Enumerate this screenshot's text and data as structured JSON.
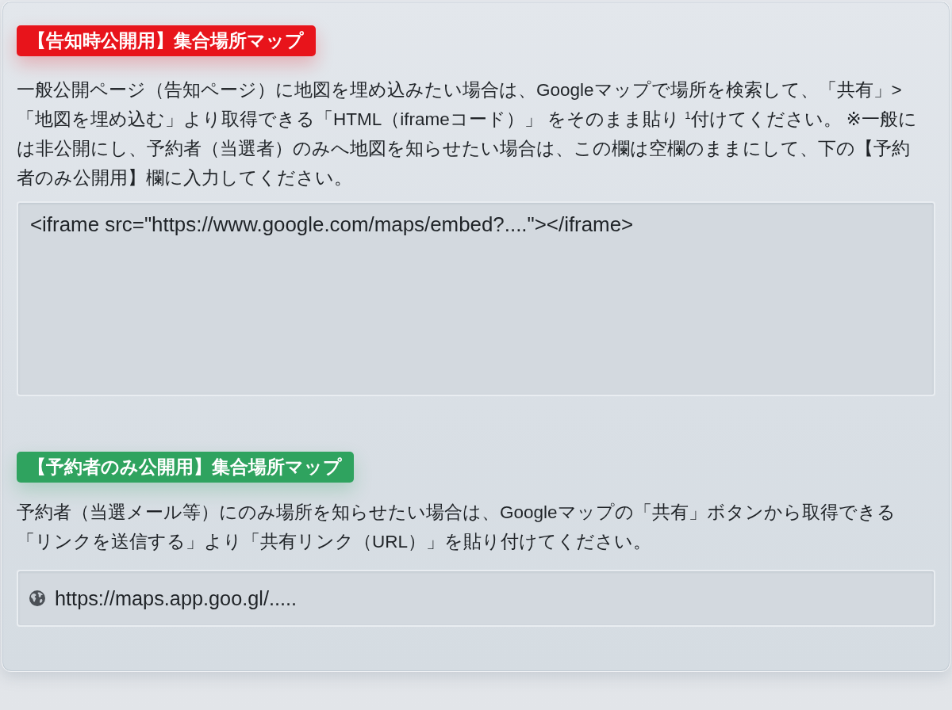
{
  "sections": [
    {
      "kind": "textarea",
      "badge": {
        "label": "【告知時公開用】集合場所マップ",
        "color": "#e8141b"
      },
      "description": "一般公開ページ（告知ページ）に地図を埋め込みたい場合は、Googleマップで場所を検索して、「共有」>「地図を埋め込む」より取得できる「HTML（iframeコード）」 をそのまま貼り $^{1}$付けてください。 ※一般には非公開にし、予約者（当選者）のみへ地図を知らせたい場合は、この欄は空欄のままにして、下の【予約者のみ公開用】欄に入力してください。",
      "field": {
        "value": "<iframe src=\"https://www.google.com/maps/embed?....\"></iframe>"
      }
    },
    {
      "kind": "input",
      "badge": {
        "label": "【予約者のみ公開用】集合場所マップ",
        "color": "#2fa35f"
      },
      "description": "予約者（当選メール等）にのみ場所を知らせたい場合は、Googleマップの「共有」ボタンから取得できる「リンクを送信する」より「共有リンク（URL）」を貼り付けてください。",
      "field": {
        "value": "https://maps.app.goo.gl/....."
      }
    }
  ]
}
